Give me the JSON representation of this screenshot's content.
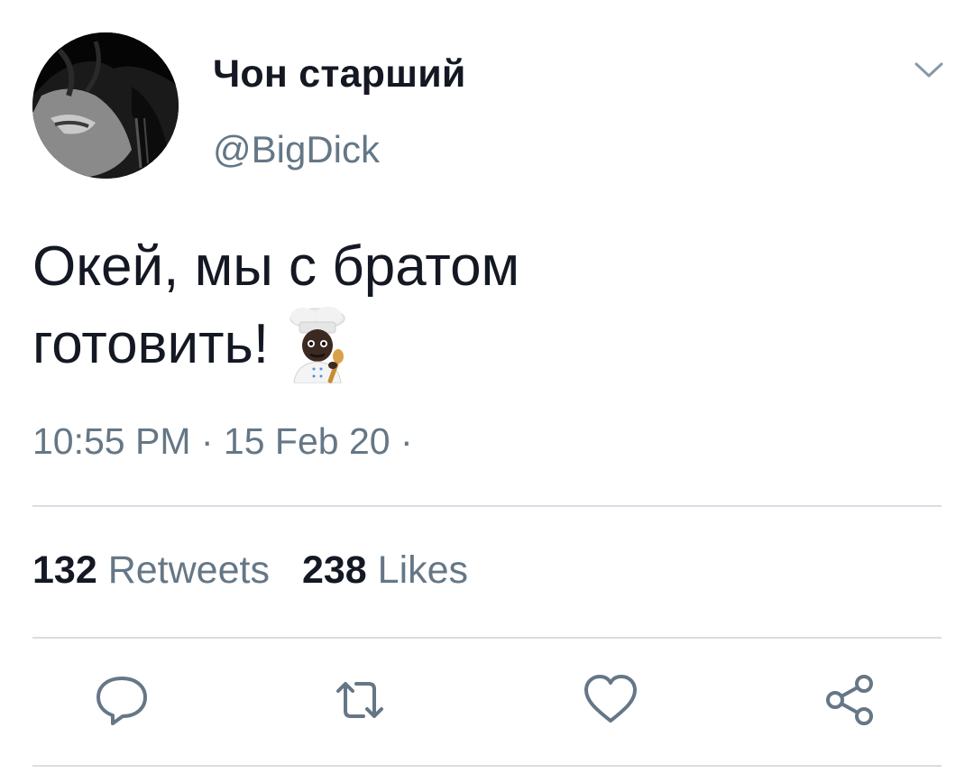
{
  "tweet": {
    "display_name": "Чон старший",
    "handle": "@BigDick",
    "text_line1": "Окей, мы с братом",
    "text_line2": "готовить!",
    "emoji": "cook-emoji",
    "timestamp": "10:55 PM · 15 Feb 20 ·"
  },
  "stats": {
    "retweets_count": "132",
    "retweets_label": "Retweets",
    "likes_count": "238",
    "likes_label": "Likes"
  },
  "actions": {
    "reply_icon": "reply-icon",
    "retweet_icon": "retweet-icon",
    "like_icon": "heart-icon",
    "share_icon": "share-icon"
  },
  "colors": {
    "text_primary": "#141823",
    "text_secondary": "#657786",
    "icon": "#657786",
    "divider": "#d8dee4",
    "background": "#ffffff"
  }
}
